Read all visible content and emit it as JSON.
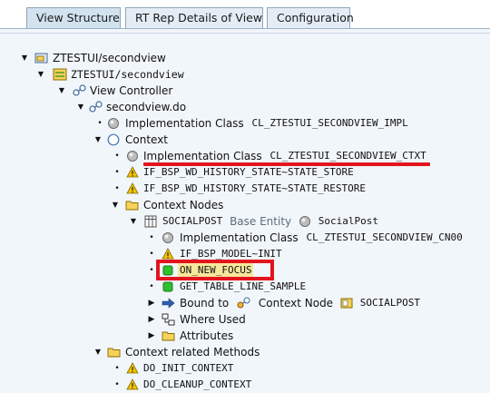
{
  "tabs": [
    {
      "label": "View Structure",
      "active": true
    },
    {
      "label": "RT Rep Details of View",
      "active": false
    },
    {
      "label": "Configuration",
      "active": false
    }
  ],
  "tree": {
    "r0": {
      "label": "ZTESTUI/secondview"
    },
    "r1": {
      "label": "ZTESTUI/secondview"
    },
    "r2": {
      "label": "View Controller"
    },
    "r3": {
      "label": "secondview.do"
    },
    "r4": {
      "label": "Implementation Class",
      "code": "CL_ZTESTUI_SECONDVIEW_IMPL"
    },
    "r5": {
      "label": "Context"
    },
    "r6": {
      "label": "Implementation Class",
      "code": "CL_ZTESTUI_SECONDVIEW_CTXT"
    },
    "r7": {
      "code": "IF_BSP_WD_HISTORY_STATE~STATE_STORE"
    },
    "r8": {
      "code": "IF_BSP_WD_HISTORY_STATE~STATE_RESTORE"
    },
    "r9": {
      "label": "Context Nodes"
    },
    "r10": {
      "code": "SOCIALPOST",
      "base_label": "Base Entity",
      "entity": "SocialPost"
    },
    "r11": {
      "label": "Implementation Class",
      "code": "CL_ZTESTUI_SECONDVIEW_CN00"
    },
    "r12": {
      "code": "IF_BSP_MODEL~INIT"
    },
    "r13": {
      "code": "ON_NEW_FOCUS"
    },
    "r14": {
      "code": "GET_TABLE_LINE_SAMPLE"
    },
    "r15": {
      "label": "Bound to",
      "node_label": "Context Node",
      "code": "SOCIALPOST"
    },
    "r16": {
      "label": "Where Used"
    },
    "r17": {
      "label": "Attributes"
    },
    "r18": {
      "label": "Context related Methods"
    },
    "r19": {
      "code": "DO_INIT_CONTEXT"
    },
    "r20": {
      "code": "DO_CLEANUP_CONTEXT"
    }
  },
  "colors": {
    "highlight": "#e3141e",
    "folder": "#f5d35a",
    "warning": "#f2c300",
    "method_green": "#2fbf2f",
    "selection": "#f6e79a"
  },
  "icons": {
    "expand": "triangle-down-icon",
    "collapsed": "triangle-right-icon",
    "leaf": "bullet-icon",
    "folder": "folder-icon",
    "view": "view-icon",
    "controller": "controller-icon",
    "class": "class-circle-icon",
    "context": "context-circle-icon",
    "warning": "warning-triangle-icon",
    "method": "green-square-icon",
    "table": "table-icon",
    "arrow": "blue-arrow-icon",
    "where_used": "where-used-icon"
  }
}
